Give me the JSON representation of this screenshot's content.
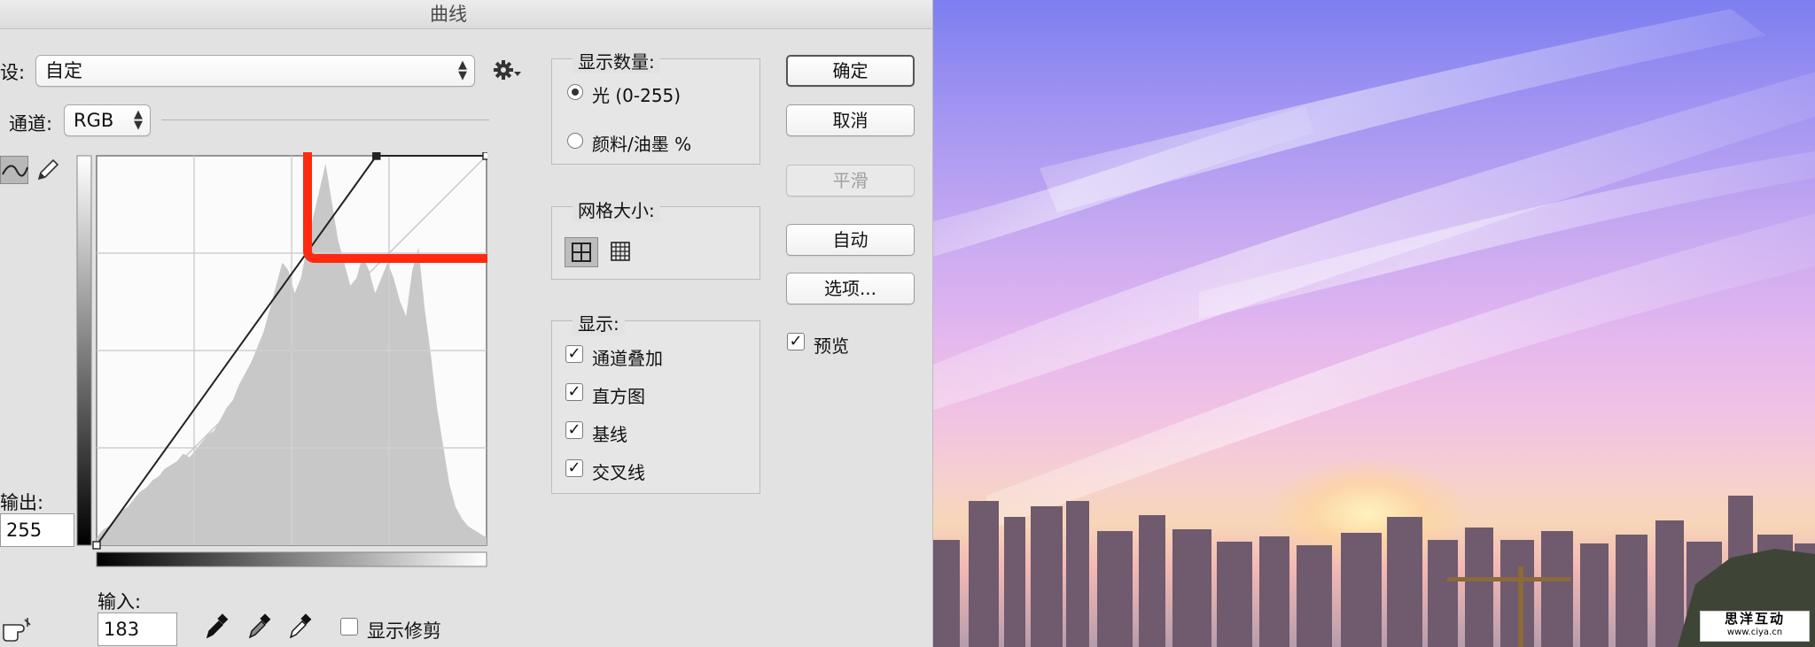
{
  "dialog": {
    "title": "曲线",
    "preset_label": "设:",
    "preset_value": "自定",
    "channel_label": "通道:",
    "channel_value": "RGB",
    "output_label": "输出:",
    "output_value": "255",
    "input_label": "输入:",
    "input_value": "183",
    "show_clipping_label": "显示修剪",
    "show_clipping_checked": false
  },
  "display_amount": {
    "title": "显示数量:",
    "options": [
      {
        "label": "光 (0-255)",
        "selected": true
      },
      {
        "label": "颜料/油墨 %",
        "selected": false
      }
    ]
  },
  "grid_size": {
    "title": "网格大小:"
  },
  "show": {
    "title": "显示:",
    "options": [
      {
        "label": "通道叠加",
        "checked": true
      },
      {
        "label": "直方图",
        "checked": true
      },
      {
        "label": "基线",
        "checked": true
      },
      {
        "label": "交叉线",
        "checked": true
      }
    ]
  },
  "buttons": {
    "ok": "确定",
    "cancel": "取消",
    "smooth": "平滑",
    "auto": "自动",
    "options": "选项..."
  },
  "preview": {
    "label": "预览",
    "checked": true
  },
  "curve": {
    "points": [
      [
        0,
        0
      ],
      [
        183,
        255
      ]
    ]
  },
  "colors": {
    "highlight_box": "#ff2a10",
    "histogram": "#c8c8c8"
  },
  "watermark": {
    "line1": "思洋互动",
    "line2": "www.ciya.cn"
  }
}
